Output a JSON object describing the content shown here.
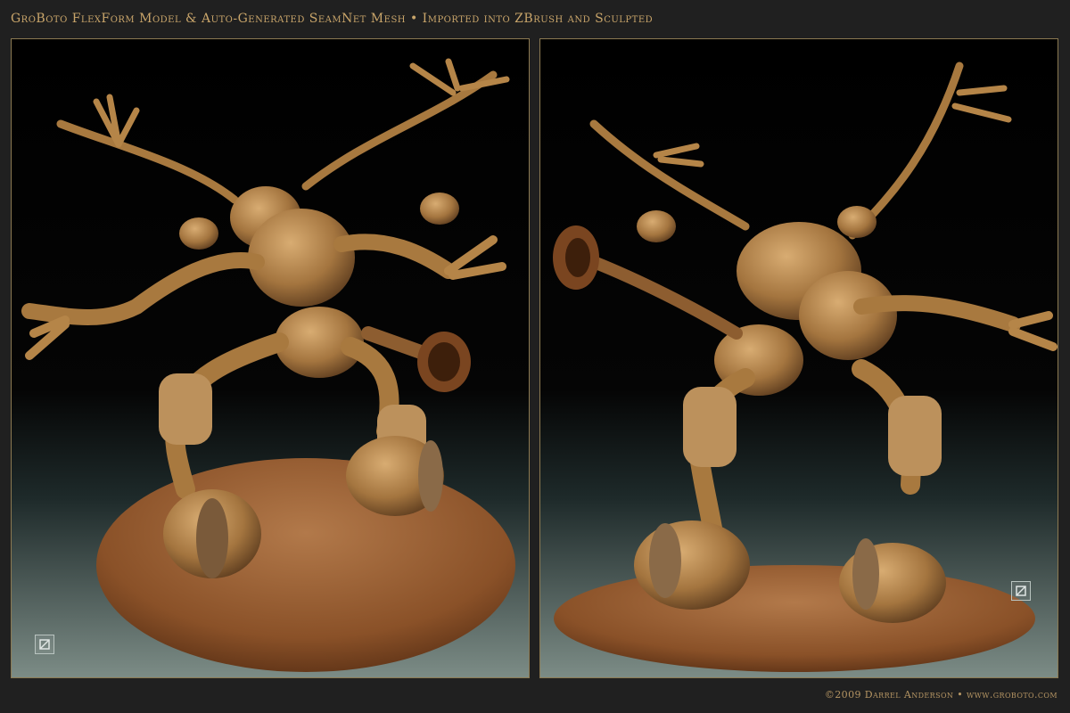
{
  "header": {
    "title": "GroBoto FlexForm Model & Auto-Generated SeamNet Mesh  •  Imported into ZBrush and Sculpted"
  },
  "footer": {
    "credit": "©2009 Darrel Anderson • www.groboto.com"
  },
  "colors": {
    "frame_bg": "#202020",
    "title_text": "#c9a56a",
    "panel_border": "#8c7a52",
    "clay": "#b88a55",
    "clay_dark": "#6e4a28",
    "base_disk": "#9a5f33"
  },
  "panels": [
    {
      "view": "front",
      "icon": "zbrush-logo-icon"
    },
    {
      "view": "side",
      "icon": "zbrush-logo-icon"
    }
  ]
}
